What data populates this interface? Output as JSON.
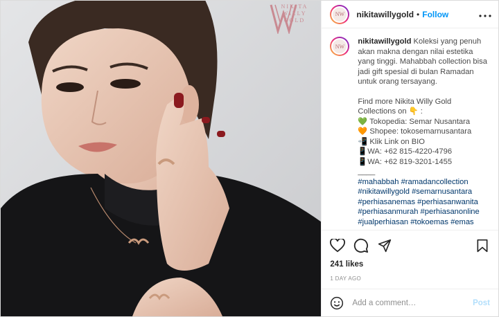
{
  "brand_logo": {
    "line1": "NIKITA WILLY",
    "line2": "GOLD"
  },
  "header": {
    "username": "nikitawillygold",
    "separator": "•",
    "follow_label": "Follow",
    "avatar_text": "NW",
    "more_icon": "more-horizontal-icon"
  },
  "caption": {
    "username": "nikitawillygold",
    "intro": "Koleksi yang penuh akan makna dengan nilai estetika yang tinggi. Mahabbah collection bisa jadi gift spesial di bulan Ramadan untuk orang tersayang.",
    "find_more": "Find more Nikita Willy Gold Collections on 👇 :",
    "lines": [
      "💚 Tokopedia: Semar Nusantara",
      "🧡 Shopee: tokosemarnusantara",
      "📲 Klik Link on BIO",
      "📱WA: +62 815-4220-4796",
      "📱WA: +62 819-3201-1455",
      "____"
    ],
    "hashtags": "#mahabbah #ramadancollection #nikitawillygold #semarnusantara #perhiasanemas #perhiasanwanita #perhiasanmurah #perhiasanonline #jualperhiasan #tokoemas #emas"
  },
  "actions": {
    "like_icon": "heart-icon",
    "comment_icon": "comment-icon",
    "share_icon": "share-icon",
    "save_icon": "bookmark-icon"
  },
  "likes": "241 likes",
  "time_ago": "1 DAY AGO",
  "comment_box": {
    "placeholder": "Add a comment…",
    "post_label": "Post",
    "emoji_icon": "smiley-icon"
  },
  "colors": {
    "link_blue": "#0095f6",
    "post_disabled": "#b2dffc",
    "hashtag": "#00376b",
    "brand_rose": "#c98a92"
  }
}
